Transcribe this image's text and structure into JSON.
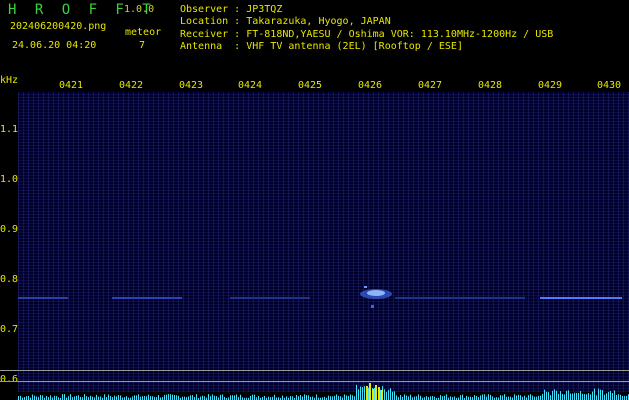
{
  "app": {
    "title": "H R O F F T",
    "version": "1.0.0"
  },
  "file": {
    "name": "202406200420.png",
    "datetime": "24.06.20 04:20"
  },
  "meteor": {
    "label": "meteor",
    "count": "7"
  },
  "station": [
    "Observer : JP3TQZ",
    "Location : Takarazuka, Hyogo, JAPAN",
    "Receiver : FT-818ND,YAESU / Oshima VOR: 113.10MHz-1200Hz / USB",
    "Antenna  : VHF TV antenna (2EL) [Rooftop / ESE]"
  ],
  "axes": {
    "y_unit": "kHz",
    "y_ticks": [
      "1.1",
      "1.0",
      "0.9",
      "0.8",
      "0.7",
      "0.6"
    ],
    "x_ticks": [
      "0421",
      "0422",
      "0423",
      "0424",
      "0425",
      "0426",
      "0427",
      "0428",
      "0429",
      "0430"
    ]
  },
  "colors": {
    "background": "#000000",
    "text": "#e6e600",
    "title": "#3cd23c",
    "signal": "#4a7bff",
    "echo_core": "#a0c8ff",
    "spectrum": "#40e0ff"
  }
}
